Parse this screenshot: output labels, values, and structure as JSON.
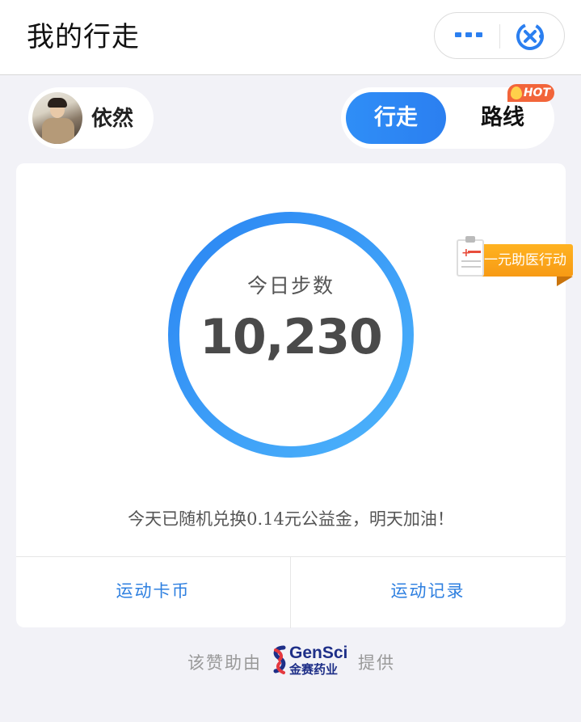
{
  "header": {
    "title": "我的行走",
    "more_icon": "more-dots-icon",
    "close_icon": "close-miniprogram-icon"
  },
  "user": {
    "name": "依然"
  },
  "mode_toggle": {
    "walk_label": "行走",
    "route_label": "路线",
    "hot_badge": "HOT",
    "active": "walk"
  },
  "promo": {
    "label": "一元助医行动",
    "icon": "medical-clipboard-icon"
  },
  "steps_card": {
    "label": "今日步数",
    "value": "10,230",
    "note": "今天已随机兑换0.14元公益金，明天加油！",
    "links": {
      "coins": "运动卡币",
      "records": "运动记录"
    }
  },
  "sponsor": {
    "prefix": "该赞助由",
    "brand_en": "GenSci",
    "brand_cn": "金赛药业",
    "suffix": "提供"
  },
  "colors": {
    "accent": "#2b7ff0",
    "ring_start": "#2a85f3",
    "ring_end": "#4db4fb",
    "hot": "#f2653a",
    "promo": "#f79a14",
    "link": "#2d7fe0"
  }
}
